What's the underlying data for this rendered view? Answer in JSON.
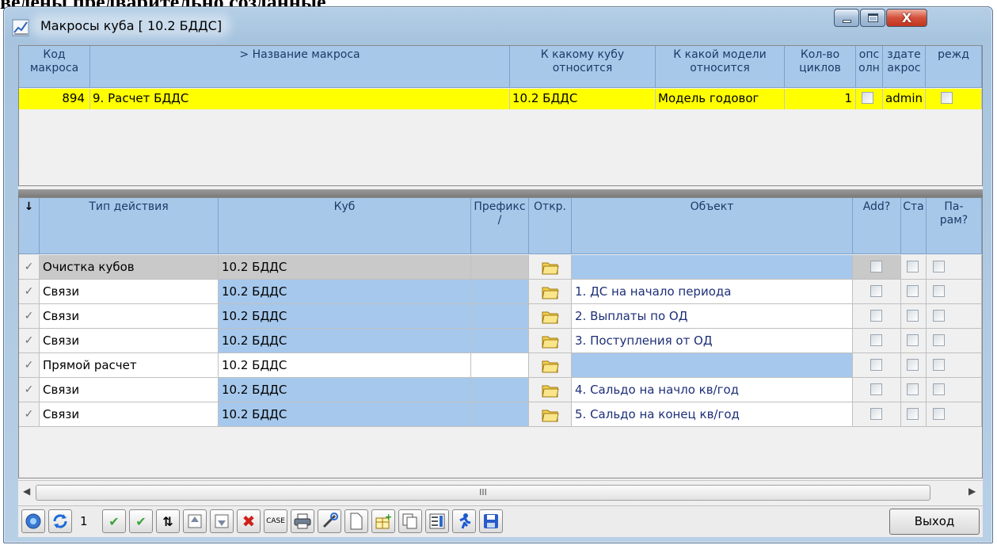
{
  "window": {
    "title": "Макросы куба [ 10.2 БДДС]",
    "close_glyph": "X"
  },
  "doc_fragment": "ведены предварительно созданные",
  "macros_table": {
    "headers": {
      "code": "Код\nмакроса",
      "name": "> Название макроса",
      "cube": "К какому кубу\nотносится",
      "model": "К какой модели\nотносится",
      "cycles": "Кол-во\nциклов",
      "opt": "опс\nолн",
      "creator": "здате\nакрос",
      "warn": "режд"
    },
    "rows": [
      {
        "code": "894",
        "name": "9. Расчет БДДС",
        "cube": "10.2 БДДС",
        "model": "Модель годовог",
        "cycles": "1",
        "opt_checked": false,
        "creator": "admin",
        "warn_checked": false
      }
    ]
  },
  "actions_table": {
    "headers": {
      "sort": "↓",
      "type": "Тип действия",
      "cube": "Куб",
      "prefix": "Префикс\n/",
      "open": "Откр.",
      "object": "Объект",
      "add": "Add?",
      "sta": "Ста",
      "param": "Па-\nрам?"
    },
    "rows": [
      {
        "mark": "✓",
        "type": "Очистка кубов",
        "cube": "10.2 БДДС",
        "object": ""
      },
      {
        "mark": "✓",
        "type": "Связи",
        "cube": "10.2 БДДС",
        "object": "1. ДС на начало периода"
      },
      {
        "mark": "✓",
        "type": "Связи",
        "cube": "10.2 БДДС",
        "object": "2. Выплаты по ОД"
      },
      {
        "mark": "✓",
        "type": "Связи",
        "cube": "10.2 БДДС",
        "object": "3. Поступления от ОД"
      },
      {
        "mark": "✓",
        "type": "Прямой расчет",
        "cube": "10.2 БДДС",
        "object": ""
      },
      {
        "mark": "✓",
        "type": "Связи",
        "cube": "10.2 БДДС",
        "object": "4. Сальдо на начло кв/год"
      },
      {
        "mark": "✓",
        "type": "Связи",
        "cube": "10.2 БДДС",
        "object": "5. Сальдо на конец кв/год"
      }
    ]
  },
  "scrollbar": {
    "thumb_grip": "III"
  },
  "toolbar": {
    "page_number": "1",
    "case_label": "CASE",
    "exit_label": "Выход",
    "icons": [
      "help-icon",
      "refresh-icon",
      "check-icon",
      "check-all-icon",
      "sort-icon",
      "move-up-icon",
      "move-down-icon",
      "delete-icon",
      "case-icon",
      "print-icon",
      "tools-icon",
      "new-doc-icon",
      "add-table-icon",
      "copy-icon",
      "columns-icon",
      "run-icon",
      "save-icon"
    ]
  },
  "colors": {
    "selected_row": "#ffff00",
    "header_blue": "#a8c8ea",
    "cell_blue": "#a6c8ec",
    "object_text": "#1e2f78"
  }
}
